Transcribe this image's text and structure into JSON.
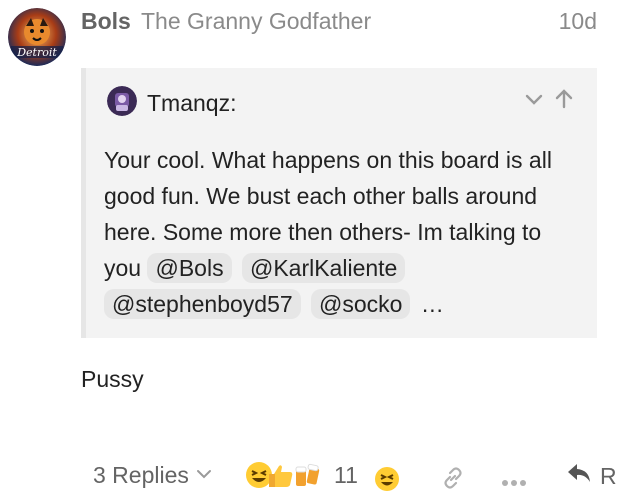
{
  "post": {
    "username": "Bols",
    "full_name": "The Granny Godfather",
    "date": "10d",
    "avatar_text": "Detroit",
    "text": "Pussy"
  },
  "quote": {
    "username": "Tmanqz:",
    "text_lines": "Your cool. What happens on this board is all good fun. We bust each other balls around here. Some more then others- Im talking to you",
    "mentions": [
      "@Bols",
      "@KarlKaliente",
      "@stephenboyd57",
      "@socko"
    ],
    "ellipsis": "…"
  },
  "footer": {
    "replies_label": "3 Replies",
    "reaction_count": "11",
    "reply_label": "R"
  },
  "icons": {
    "expand": "chevron-down-icon",
    "collapse": "arrow-up-icon",
    "link": "link-icon",
    "more": "more-icon",
    "reply": "reply-arrow-icon"
  }
}
